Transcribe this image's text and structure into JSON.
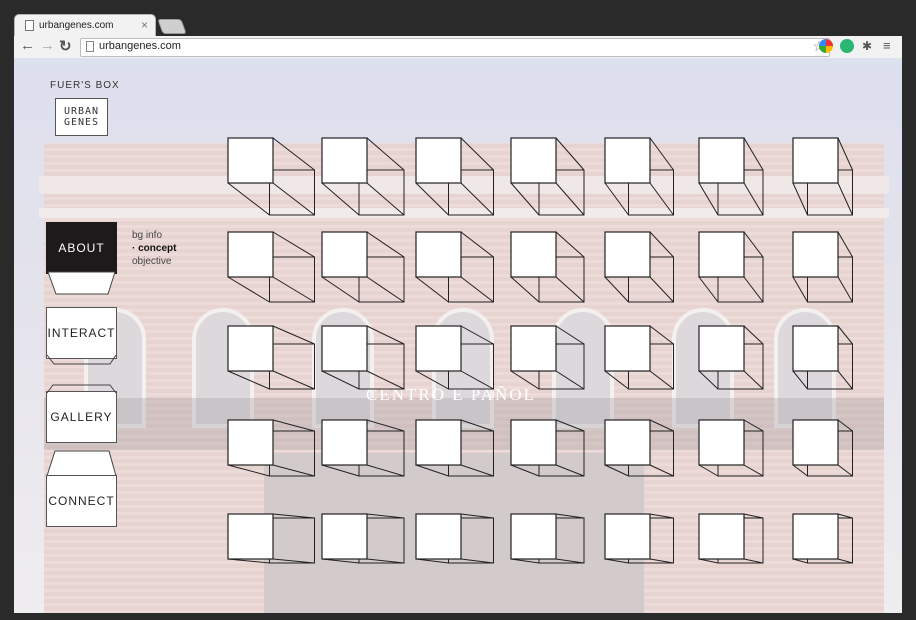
{
  "browser": {
    "tab_title": "urbangenes.com",
    "tab_close": "×",
    "url": "urbangenes.com"
  },
  "sidebar": {
    "brand": "FUER'S BOX",
    "logo_line1": "URBAN",
    "logo_line2": "GENES",
    "nav": [
      {
        "label": "ABOUT",
        "active": true
      },
      {
        "label": "INTERACT",
        "active": false
      },
      {
        "label": "GALLERY",
        "active": false
      },
      {
        "label": "CONNECT",
        "active": false
      }
    ],
    "subnav": [
      "bg info",
      "· concept",
      "objective"
    ]
  },
  "background": {
    "sign_text": "CENTRO E PAÑOL"
  },
  "grid": {
    "rows": 5,
    "cols": 7
  },
  "colors": {
    "active_nav": "#1c1a1a",
    "cube_stroke": "#222222"
  }
}
